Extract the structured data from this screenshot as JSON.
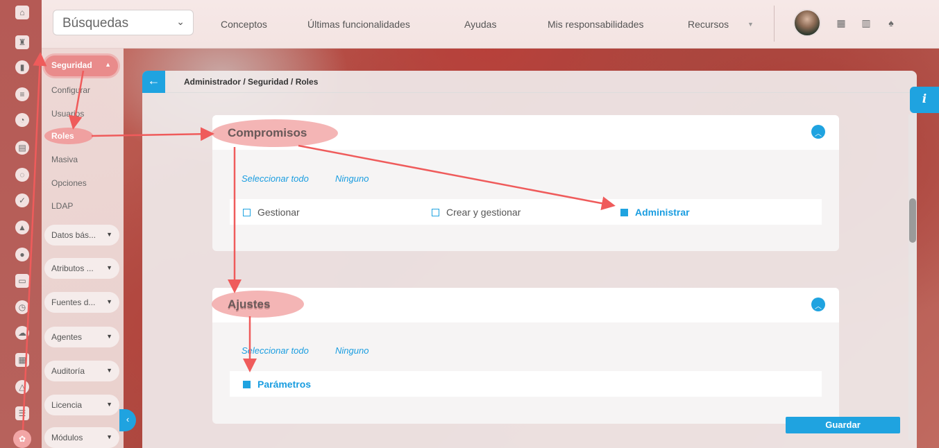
{
  "topbar": {
    "search_label": "Búsquedas",
    "nav": [
      "Conceptos",
      "Últimas funcionalidades",
      "Ayudas",
      "Mis responsabilidades",
      "Recursos"
    ]
  },
  "rail_icons": [
    "home-icon",
    "chess-rook-icon",
    "bar-chart-icon",
    "align-icon",
    "pie-chart-icon",
    "document-icon",
    "circle-dashed-icon",
    "check-circle-icon",
    "warning-icon",
    "users-icon",
    "monitor-icon",
    "clock-icon",
    "cloud-icon",
    "calendar-icon",
    "network-icon",
    "list-icon",
    "gear-icon"
  ],
  "submenu": {
    "head": "Seguridad",
    "links": [
      "Configurar",
      "Usuarios",
      "Roles",
      "Masiva",
      "Opciones",
      "LDAP"
    ],
    "groups": [
      "Datos bás...",
      "Atributos ...",
      "Fuentes d...",
      "Agentes",
      "Auditoría",
      "Licencia",
      "Módulos"
    ]
  },
  "breadcrumb": "Administrador / Seguridad / Roles",
  "sections": [
    {
      "title": "Compromisos",
      "select_all": "Seleccionar todo",
      "none": "Ninguno",
      "options": [
        {
          "label": "Gestionar",
          "checked": false
        },
        {
          "label": "Crear y gestionar",
          "checked": false
        },
        {
          "label": "Administrar",
          "checked": true
        }
      ]
    },
    {
      "title": "Ajustes",
      "select_all": "Seleccionar todo",
      "none": "Ninguno",
      "options": [
        {
          "label": "Parámetros",
          "checked": true
        }
      ]
    }
  ],
  "save_label": "Guardar",
  "info_label": "i",
  "colors": {
    "accent": "#1fa3e0",
    "highlight": "#f0a0a0",
    "arrow": "#ef5b5b"
  }
}
